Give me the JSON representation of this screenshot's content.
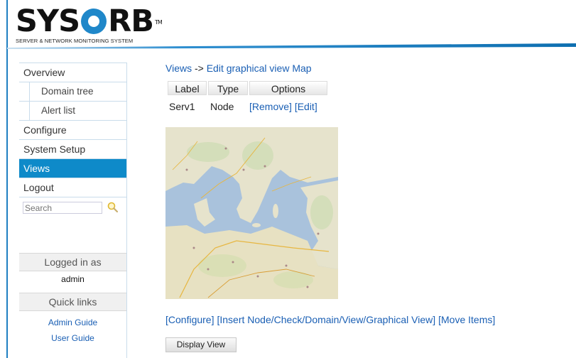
{
  "brand": {
    "logo_pre": "SYS",
    "logo_post": "RB",
    "trademark": "TM",
    "tagline": "SERVER & NETWORK MONITORING SYSTEM",
    "accent_color": "#1f87c9"
  },
  "sidebar": {
    "items": [
      {
        "label": "Overview",
        "active": false
      },
      {
        "label": "Domain tree",
        "active": false,
        "sub": true
      },
      {
        "label": "Alert list",
        "active": false,
        "sub": true
      },
      {
        "label": "Configure",
        "active": false
      },
      {
        "label": "System Setup",
        "active": false
      },
      {
        "label": "Views",
        "active": true
      },
      {
        "label": "Logout",
        "active": false
      }
    ],
    "search_placeholder": "Search",
    "logged_in_label": "Logged in as",
    "username": "admin",
    "quick_links_label": "Quick links",
    "quick_links": [
      "Admin Guide",
      "User Guide"
    ]
  },
  "main": {
    "breadcrumb": {
      "parent": "Views",
      "separator": "->",
      "current": "Edit graphical view Map"
    },
    "table": {
      "headers": [
        "Label",
        "Type",
        "Options"
      ],
      "rows": [
        {
          "label": "Serv1",
          "type": "Node",
          "remove": "[Remove]",
          "edit": "[Edit]"
        }
      ]
    },
    "actions": [
      "[Configure]",
      "[Insert Node/Check/Domain/View/Graphical View]",
      "[Move Items]"
    ],
    "display_button": "Display View"
  }
}
